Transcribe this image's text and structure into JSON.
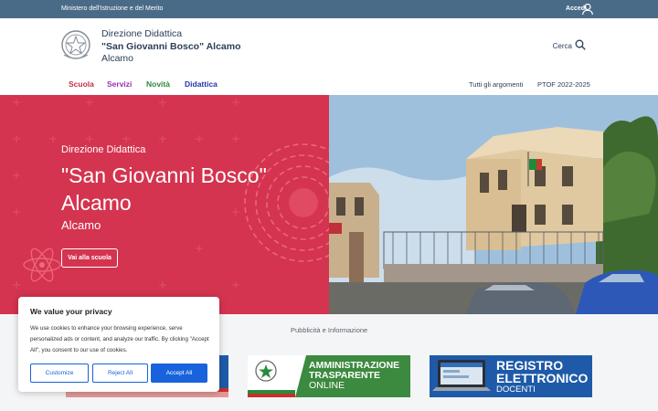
{
  "topbar": {
    "ministry": "Ministero dell'Istruzione e del Merito",
    "login_label": "Accedi"
  },
  "header": {
    "name_line1": "Direzione Didattica",
    "name_line2": "\"San Giovanni Bosco\" Alcamo",
    "name_line3": "Alcamo",
    "search_label": "Cerca"
  },
  "nav": {
    "items": [
      "Scuola",
      "Servizi",
      "Novità",
      "Didattica"
    ],
    "right_items": [
      "Tutti gli argomenti",
      "PTOF 2022-2025"
    ],
    "colors": [
      "#c0304a",
      "#9b2fb0",
      "#2a8a3c",
      "#2a34a8"
    ]
  },
  "hero": {
    "label": "Direzione Didattica",
    "title_line1": "\"San Giovanni Bosco\"",
    "title_line2": "Alcamo",
    "subtitle": "Alcamo",
    "cta_label": "Vai alla scuola",
    "accent_color": "#d4344f"
  },
  "section": {
    "label": "Pubblicità e Informazione"
  },
  "banners": {
    "amministrazione": {
      "line1": "AMMINISTRAZIONE",
      "line2": "TRASPARENTE",
      "line3": "ONLINE"
    },
    "registro": {
      "line1": "REGISTRO",
      "line2": "ELETTRONICO",
      "line3": "DOCENTI"
    }
  },
  "cookie": {
    "title": "We value your privacy",
    "text": "We use cookies to enhance your browsing experience, serve personalized ads or content, and analyze our traffic. By clicking \"Accept All\", you consent to our use of cookies.",
    "customize_label": "Customize",
    "reject_label": "Reject All",
    "accept_label": "Accept All"
  }
}
